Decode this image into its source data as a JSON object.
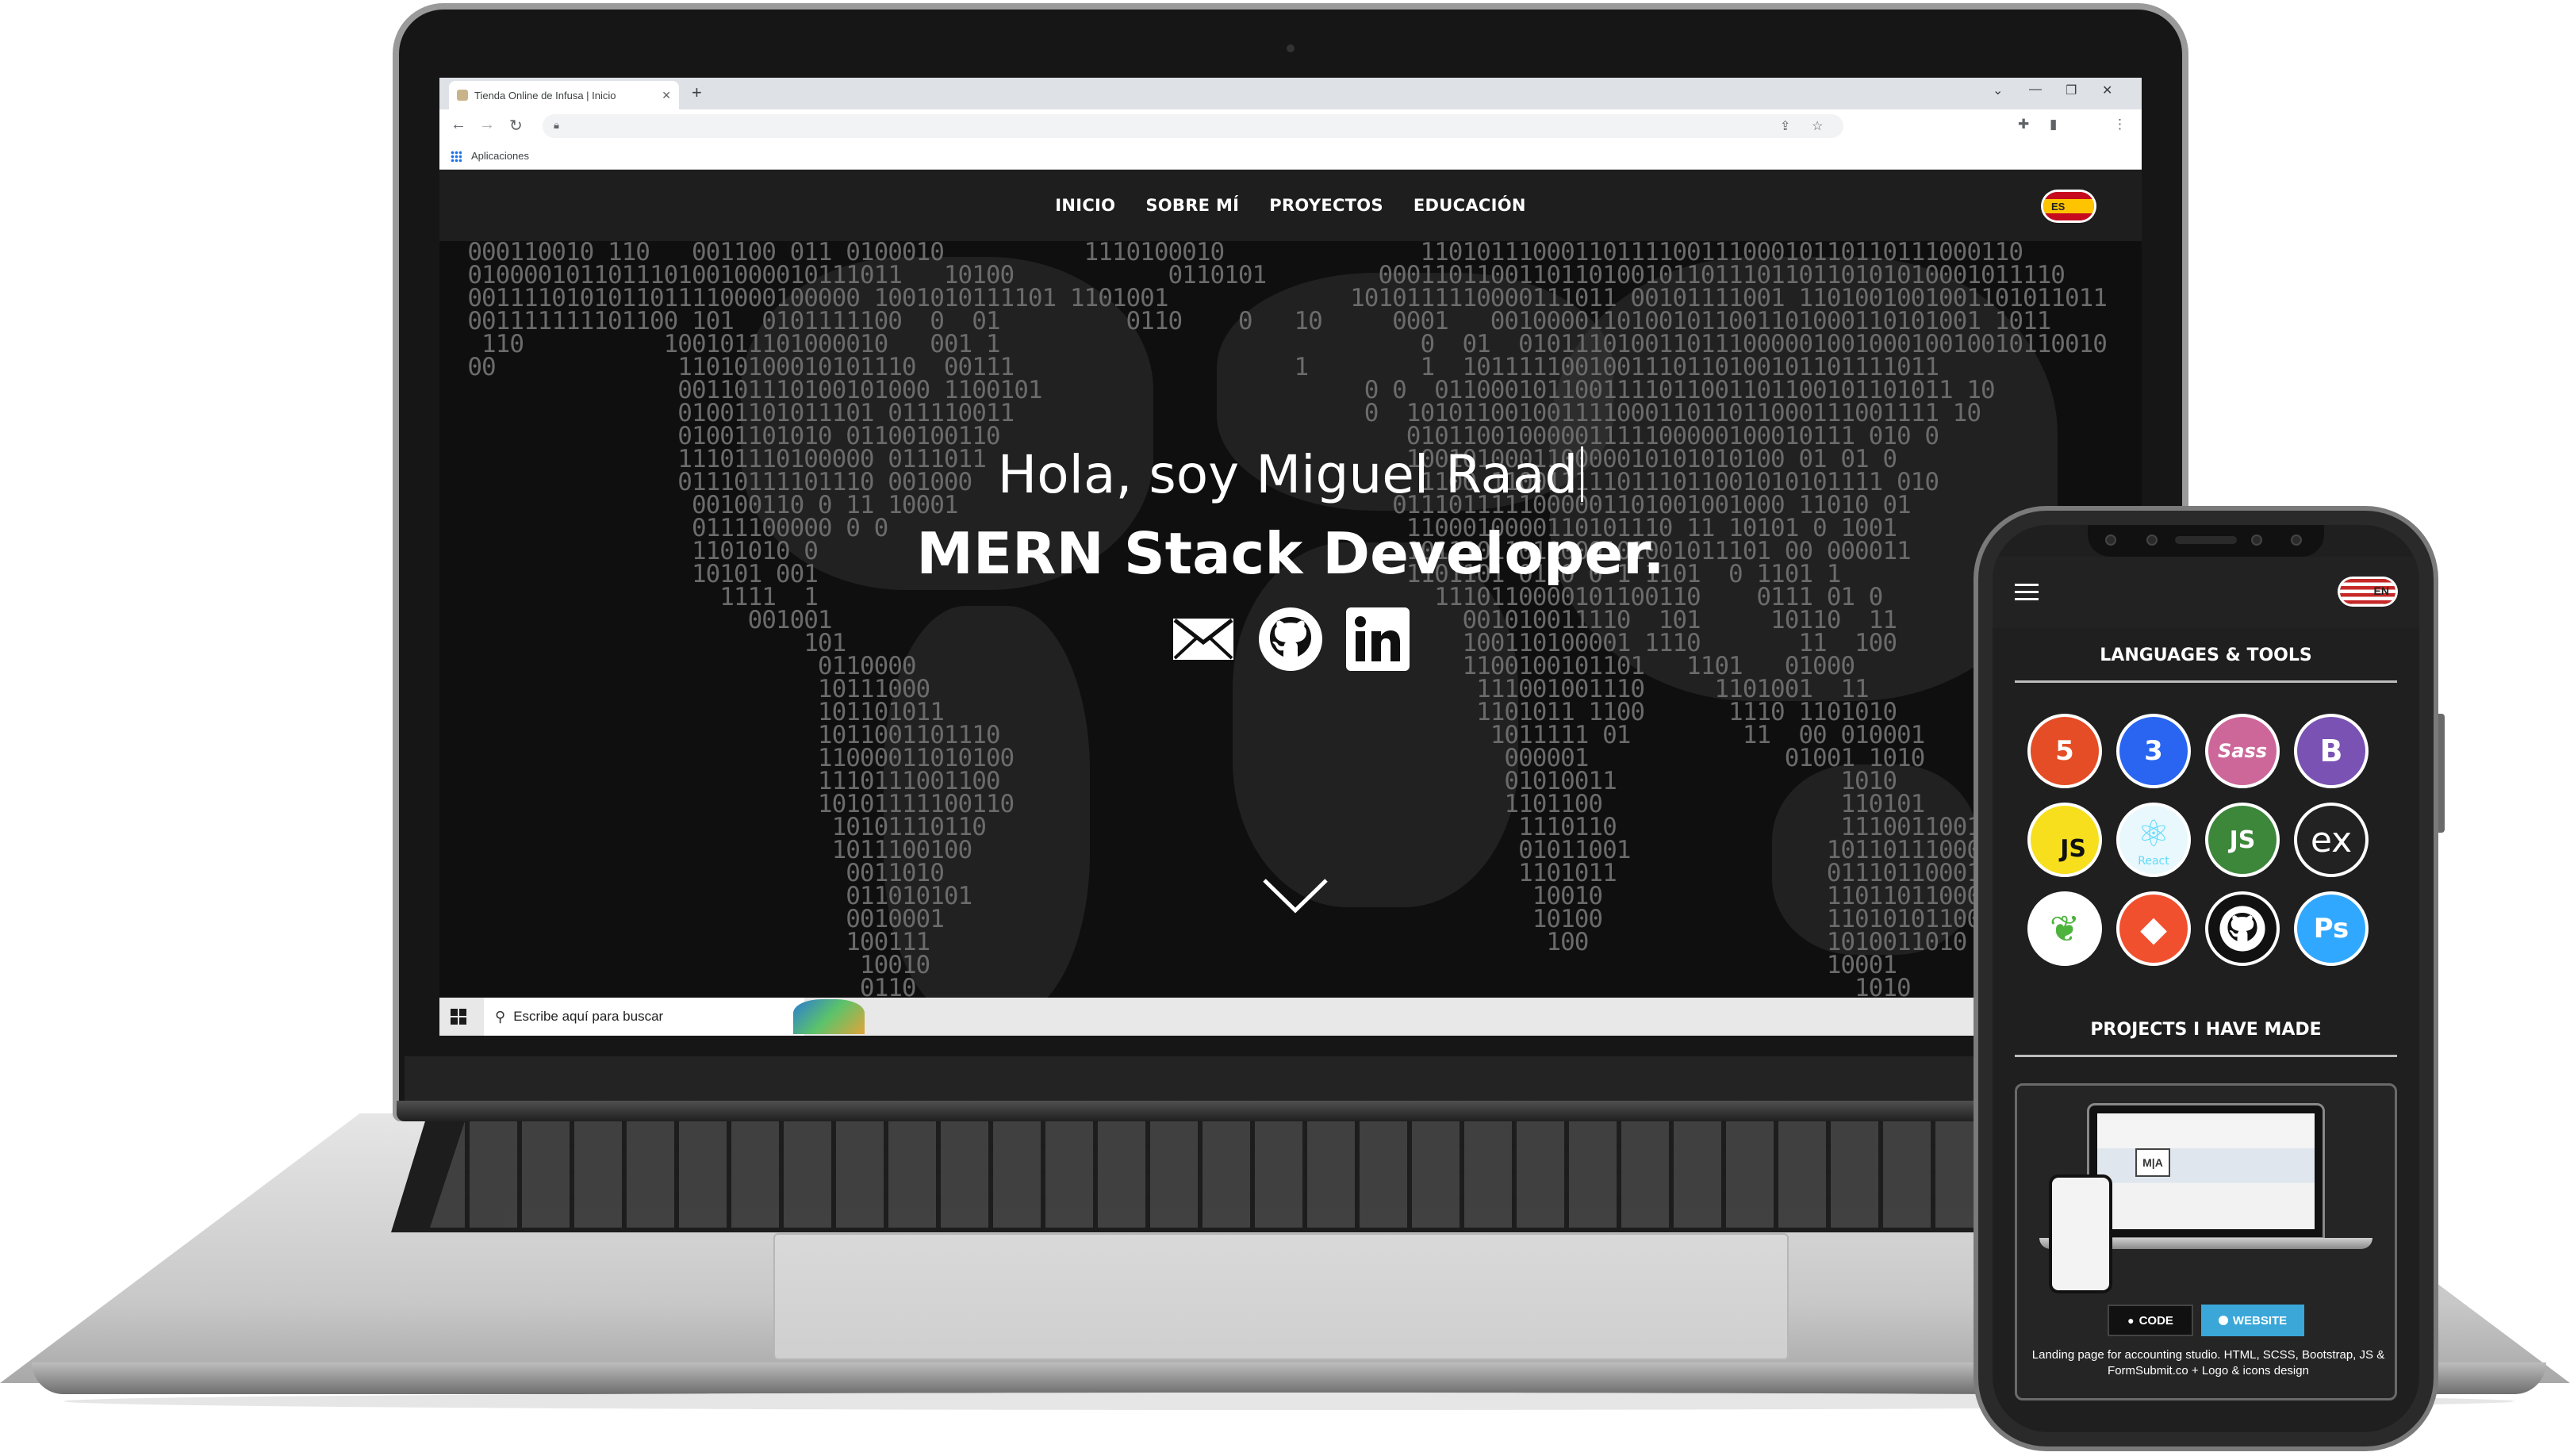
{
  "browser": {
    "tab_title": "Tienda Online de Infusa | Inicio",
    "bookmarks_label": "Aplicaciones",
    "new_tab": "+",
    "tab_close": "✕"
  },
  "site": {
    "nav": [
      "INICIO",
      "SOBRE MÍ",
      "PROYECTOS",
      "EDUCACIÓN"
    ],
    "language_flag": "ES",
    "hero_line1": "Hola, soy Miguel Raad",
    "hero_line2": "MERN Stack Developer."
  },
  "taskbar": {
    "search_placeholder": "Escribe aquí para buscar"
  },
  "phone": {
    "language_flag": "EN",
    "section_tools": "LANGUAGES & TOOLS",
    "section_projects": "PROJECTS I HAVE MADE",
    "tools": [
      {
        "icon": "html5-icon",
        "label": "HTML",
        "glyph": "5",
        "color": "#e44d26"
      },
      {
        "icon": "css3-icon",
        "label": "CSS",
        "glyph": "3",
        "color": "#2965f1"
      },
      {
        "icon": "sass-icon",
        "label": "",
        "glyph": "Sass",
        "color": "#cd6799"
      },
      {
        "icon": "bootstrap-icon",
        "label": "",
        "glyph": "B",
        "color": "#7952b3"
      },
      {
        "icon": "javascript-icon",
        "label": "",
        "glyph": "JS",
        "color": "#f7df1e"
      },
      {
        "icon": "react-icon",
        "label": "React",
        "glyph": "⚛",
        "color": "#61dafb"
      },
      {
        "icon": "nodejs-icon",
        "label": "",
        "glyph": "JS",
        "color": "#3c873a"
      },
      {
        "icon": "express-icon",
        "label": "",
        "glyph": "ex",
        "color": "#222222"
      },
      {
        "icon": "mongodb-icon",
        "label": "",
        "glyph": "❦",
        "color": "#4db33d"
      },
      {
        "icon": "git-icon",
        "label": "",
        "glyph": "◆",
        "color": "#f1502f"
      },
      {
        "icon": "github-icon",
        "label": "",
        "glyph": "",
        "color": "#111111"
      },
      {
        "icon": "photoshop-icon",
        "label": "",
        "glyph": "Ps",
        "color": "#31a8ff"
      }
    ],
    "project": {
      "mock_logo": "M|A",
      "code_label": "CODE",
      "website_label": "WEBSITE",
      "description": "Landing page for accounting studio. HTML, SCSS, Bootstrap, JS & FormSubmit.co + Logo & icons design"
    }
  }
}
